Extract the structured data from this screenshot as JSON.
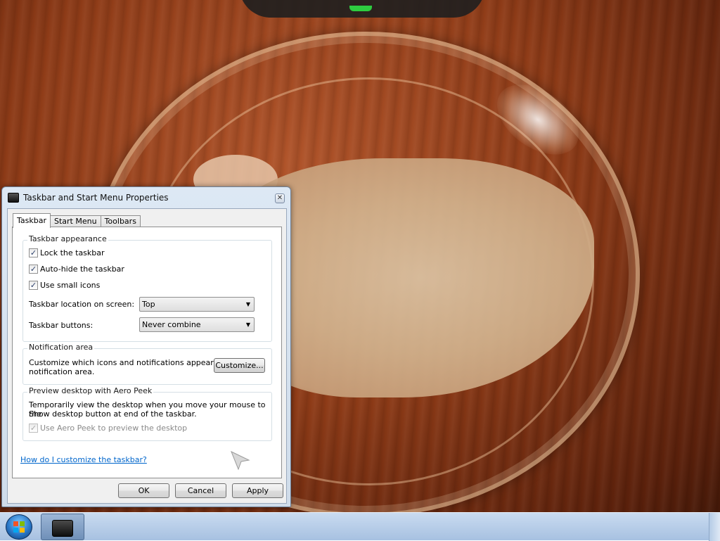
{
  "window": {
    "title": "Taskbar and Start Menu Properties",
    "close_symbol": "✕"
  },
  "tabs": [
    {
      "label": "Taskbar",
      "active": true
    },
    {
      "label": "Start Menu",
      "active": false
    },
    {
      "label": "Toolbars",
      "active": false
    }
  ],
  "appearance": {
    "group_title": "Taskbar appearance",
    "lock_label": "Lock the taskbar",
    "lock_checked": true,
    "autohide_label": "Auto-hide the taskbar",
    "autohide_checked": true,
    "small_icons_label": "Use small icons",
    "small_icons_checked": true,
    "location_label": "Taskbar location on screen:",
    "location_value": "Top",
    "buttons_label": "Taskbar buttons:",
    "buttons_value": "Never combine"
  },
  "notification": {
    "group_title": "Notification area",
    "description_line1": "Customize which icons and notifications appear in the",
    "description_line2": "notification area.",
    "customize_button": "Customize..."
  },
  "aero_peek": {
    "group_title": "Preview desktop with Aero Peek",
    "description_line1": "Temporarily view the desktop when you move your mouse to the",
    "description_line2": "Show desktop button at end of the taskbar.",
    "checkbox_label": "Use Aero Peek to preview the desktop",
    "checkbox_checked": true,
    "checkbox_disabled": true
  },
  "help_link": "How do I customize the taskbar?",
  "buttons": {
    "ok": "OK",
    "cancel": "Cancel",
    "apply": "Apply"
  },
  "check_mark": "✓",
  "dropdown_arrow": "▼",
  "icons": [
    "window-icon",
    "close-icon",
    "windows-logo-icon",
    "taskbar-window-icon",
    "mouse-cursor-icon"
  ],
  "colors": {
    "link": "#0066cc",
    "taskbar": "#b8cde8",
    "start_orb": "#2a78c8"
  }
}
